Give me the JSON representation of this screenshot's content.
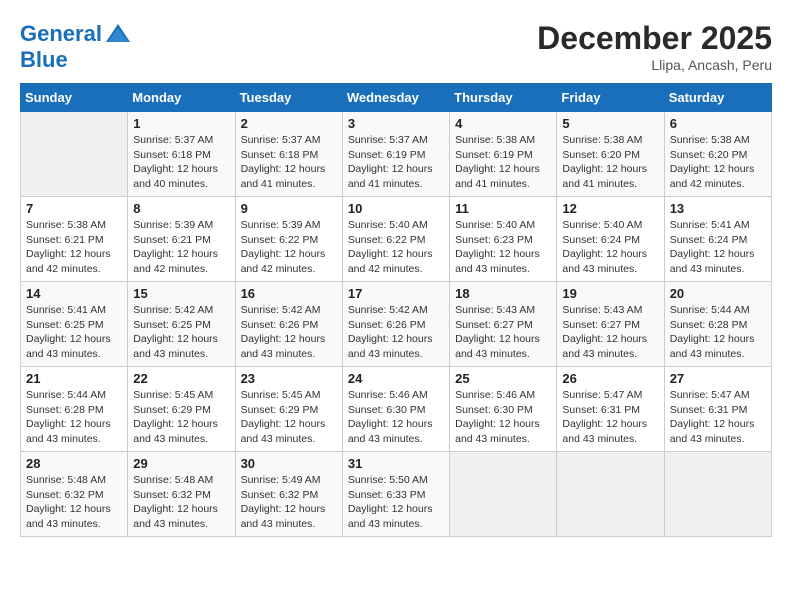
{
  "header": {
    "logo_line1": "General",
    "logo_line2": "Blue",
    "month": "December 2025",
    "location": "Llipa, Ancash, Peru"
  },
  "weekdays": [
    "Sunday",
    "Monday",
    "Tuesday",
    "Wednesday",
    "Thursday",
    "Friday",
    "Saturday"
  ],
  "weeks": [
    [
      {
        "day": "",
        "info": ""
      },
      {
        "day": "1",
        "info": "Sunrise: 5:37 AM\nSunset: 6:18 PM\nDaylight: 12 hours\nand 40 minutes."
      },
      {
        "day": "2",
        "info": "Sunrise: 5:37 AM\nSunset: 6:18 PM\nDaylight: 12 hours\nand 41 minutes."
      },
      {
        "day": "3",
        "info": "Sunrise: 5:37 AM\nSunset: 6:19 PM\nDaylight: 12 hours\nand 41 minutes."
      },
      {
        "day": "4",
        "info": "Sunrise: 5:38 AM\nSunset: 6:19 PM\nDaylight: 12 hours\nand 41 minutes."
      },
      {
        "day": "5",
        "info": "Sunrise: 5:38 AM\nSunset: 6:20 PM\nDaylight: 12 hours\nand 41 minutes."
      },
      {
        "day": "6",
        "info": "Sunrise: 5:38 AM\nSunset: 6:20 PM\nDaylight: 12 hours\nand 42 minutes."
      }
    ],
    [
      {
        "day": "7",
        "info": "Sunrise: 5:38 AM\nSunset: 6:21 PM\nDaylight: 12 hours\nand 42 minutes."
      },
      {
        "day": "8",
        "info": "Sunrise: 5:39 AM\nSunset: 6:21 PM\nDaylight: 12 hours\nand 42 minutes."
      },
      {
        "day": "9",
        "info": "Sunrise: 5:39 AM\nSunset: 6:22 PM\nDaylight: 12 hours\nand 42 minutes."
      },
      {
        "day": "10",
        "info": "Sunrise: 5:40 AM\nSunset: 6:22 PM\nDaylight: 12 hours\nand 42 minutes."
      },
      {
        "day": "11",
        "info": "Sunrise: 5:40 AM\nSunset: 6:23 PM\nDaylight: 12 hours\nand 43 minutes."
      },
      {
        "day": "12",
        "info": "Sunrise: 5:40 AM\nSunset: 6:24 PM\nDaylight: 12 hours\nand 43 minutes."
      },
      {
        "day": "13",
        "info": "Sunrise: 5:41 AM\nSunset: 6:24 PM\nDaylight: 12 hours\nand 43 minutes."
      }
    ],
    [
      {
        "day": "14",
        "info": "Sunrise: 5:41 AM\nSunset: 6:25 PM\nDaylight: 12 hours\nand 43 minutes."
      },
      {
        "day": "15",
        "info": "Sunrise: 5:42 AM\nSunset: 6:25 PM\nDaylight: 12 hours\nand 43 minutes."
      },
      {
        "day": "16",
        "info": "Sunrise: 5:42 AM\nSunset: 6:26 PM\nDaylight: 12 hours\nand 43 minutes."
      },
      {
        "day": "17",
        "info": "Sunrise: 5:42 AM\nSunset: 6:26 PM\nDaylight: 12 hours\nand 43 minutes."
      },
      {
        "day": "18",
        "info": "Sunrise: 5:43 AM\nSunset: 6:27 PM\nDaylight: 12 hours\nand 43 minutes."
      },
      {
        "day": "19",
        "info": "Sunrise: 5:43 AM\nSunset: 6:27 PM\nDaylight: 12 hours\nand 43 minutes."
      },
      {
        "day": "20",
        "info": "Sunrise: 5:44 AM\nSunset: 6:28 PM\nDaylight: 12 hours\nand 43 minutes."
      }
    ],
    [
      {
        "day": "21",
        "info": "Sunrise: 5:44 AM\nSunset: 6:28 PM\nDaylight: 12 hours\nand 43 minutes."
      },
      {
        "day": "22",
        "info": "Sunrise: 5:45 AM\nSunset: 6:29 PM\nDaylight: 12 hours\nand 43 minutes."
      },
      {
        "day": "23",
        "info": "Sunrise: 5:45 AM\nSunset: 6:29 PM\nDaylight: 12 hours\nand 43 minutes."
      },
      {
        "day": "24",
        "info": "Sunrise: 5:46 AM\nSunset: 6:30 PM\nDaylight: 12 hours\nand 43 minutes."
      },
      {
        "day": "25",
        "info": "Sunrise: 5:46 AM\nSunset: 6:30 PM\nDaylight: 12 hours\nand 43 minutes."
      },
      {
        "day": "26",
        "info": "Sunrise: 5:47 AM\nSunset: 6:31 PM\nDaylight: 12 hours\nand 43 minutes."
      },
      {
        "day": "27",
        "info": "Sunrise: 5:47 AM\nSunset: 6:31 PM\nDaylight: 12 hours\nand 43 minutes."
      }
    ],
    [
      {
        "day": "28",
        "info": "Sunrise: 5:48 AM\nSunset: 6:32 PM\nDaylight: 12 hours\nand 43 minutes."
      },
      {
        "day": "29",
        "info": "Sunrise: 5:48 AM\nSunset: 6:32 PM\nDaylight: 12 hours\nand 43 minutes."
      },
      {
        "day": "30",
        "info": "Sunrise: 5:49 AM\nSunset: 6:32 PM\nDaylight: 12 hours\nand 43 minutes."
      },
      {
        "day": "31",
        "info": "Sunrise: 5:50 AM\nSunset: 6:33 PM\nDaylight: 12 hours\nand 43 minutes."
      },
      {
        "day": "",
        "info": ""
      },
      {
        "day": "",
        "info": ""
      },
      {
        "day": "",
        "info": ""
      }
    ]
  ]
}
